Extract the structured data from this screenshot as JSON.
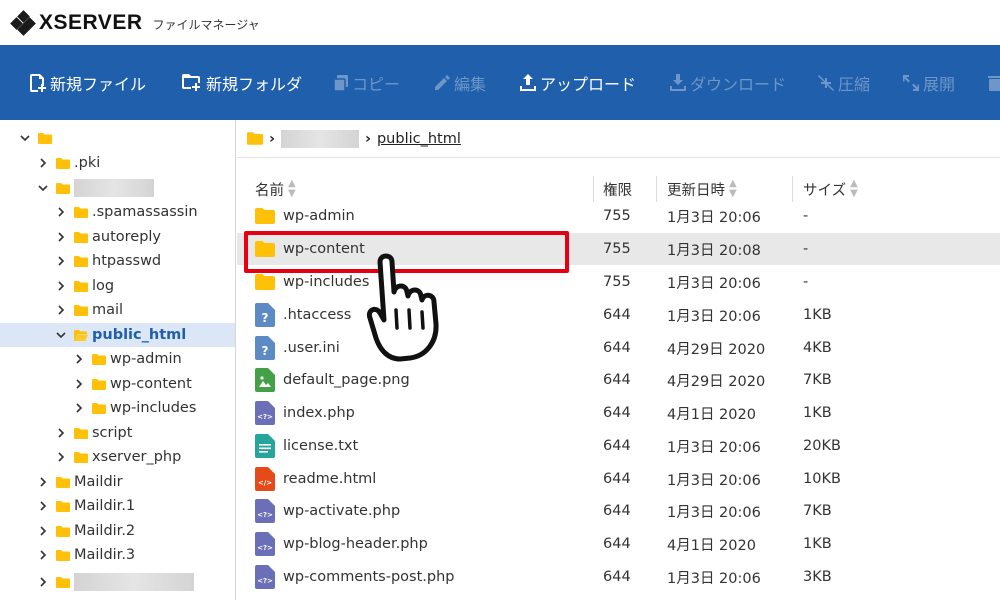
{
  "header": {
    "logo_text": "XSERVER",
    "subtitle": "ファイルマネージャ",
    "logo_icon": "xserver-diamond-logo"
  },
  "colors": {
    "toolbar_bg": "#1f5fab",
    "toolbar_text": "#ffffff",
    "toolbar_disabled": "#6f96c8",
    "selected_bg": "#dbe7f6",
    "highlight_box": "#e60012",
    "folder": "#ffc107"
  },
  "toolbar": {
    "new_file": "新規ファイル",
    "new_folder": "新規フォルダ",
    "copy": "コピー",
    "edit": "編集",
    "upload": "アップロード",
    "download": "ダウンロード",
    "compress": "圧縮",
    "extract": "展開"
  },
  "sidebar": {
    "items": [
      {
        "label": ""
      },
      {
        "label": ".pki"
      },
      {
        "label": ""
      },
      {
        "label": ".spamassassin"
      },
      {
        "label": "autoreply"
      },
      {
        "label": "htpasswd"
      },
      {
        "label": "log"
      },
      {
        "label": "mail"
      },
      {
        "label": "public_html"
      },
      {
        "label": "wp-admin"
      },
      {
        "label": "wp-content"
      },
      {
        "label": "wp-includes"
      },
      {
        "label": "script"
      },
      {
        "label": "xserver_php"
      },
      {
        "label": "Maildir"
      },
      {
        "label": "Maildir.1"
      },
      {
        "label": "Maildir.2"
      },
      {
        "label": "Maildir.3"
      },
      {
        "label": ""
      }
    ]
  },
  "breadcrumb": {
    "current": "public_html"
  },
  "table": {
    "headers": {
      "name": "名前",
      "perm": "権限",
      "date": "更新日時",
      "size": "サイズ"
    },
    "rows": [
      {
        "name": "wp-admin",
        "perm": "755",
        "date": "1月3日 20:06",
        "size": "-",
        "icon": "folder-icon"
      },
      {
        "name": "wp-content",
        "perm": "755",
        "date": "1月3日 20:08",
        "size": "-",
        "icon": "folder-icon"
      },
      {
        "name": "wp-includes",
        "perm": "755",
        "date": "1月3日 20:06",
        "size": "-",
        "icon": "folder-icon"
      },
      {
        "name": ".htaccess",
        "perm": "644",
        "date": "1月3日 20:06",
        "size": "1KB",
        "icon": "unknown-file-icon"
      },
      {
        "name": ".user.ini",
        "perm": "644",
        "date": "4月29日 2020",
        "size": "4KB",
        "icon": "unknown-file-icon"
      },
      {
        "name": "default_page.png",
        "perm": "644",
        "date": "4月29日 2020",
        "size": "7KB",
        "icon": "image-file-icon"
      },
      {
        "name": "index.php",
        "perm": "644",
        "date": "4月1日 2020",
        "size": "1KB",
        "icon": "code-file-icon"
      },
      {
        "name": "license.txt",
        "perm": "644",
        "date": "1月3日 20:06",
        "size": "20KB",
        "icon": "text-file-icon"
      },
      {
        "name": "readme.html",
        "perm": "644",
        "date": "1月3日 20:06",
        "size": "10KB",
        "icon": "html-file-icon"
      },
      {
        "name": "wp-activate.php",
        "perm": "644",
        "date": "1月3日 20:06",
        "size": "7KB",
        "icon": "code-file-icon"
      },
      {
        "name": "wp-blog-header.php",
        "perm": "644",
        "date": "4月1日 2020",
        "size": "1KB",
        "icon": "code-file-icon"
      },
      {
        "name": "wp-comments-post.php",
        "perm": "644",
        "date": "1月3日 20:06",
        "size": "3KB",
        "icon": "code-file-icon"
      }
    ]
  }
}
